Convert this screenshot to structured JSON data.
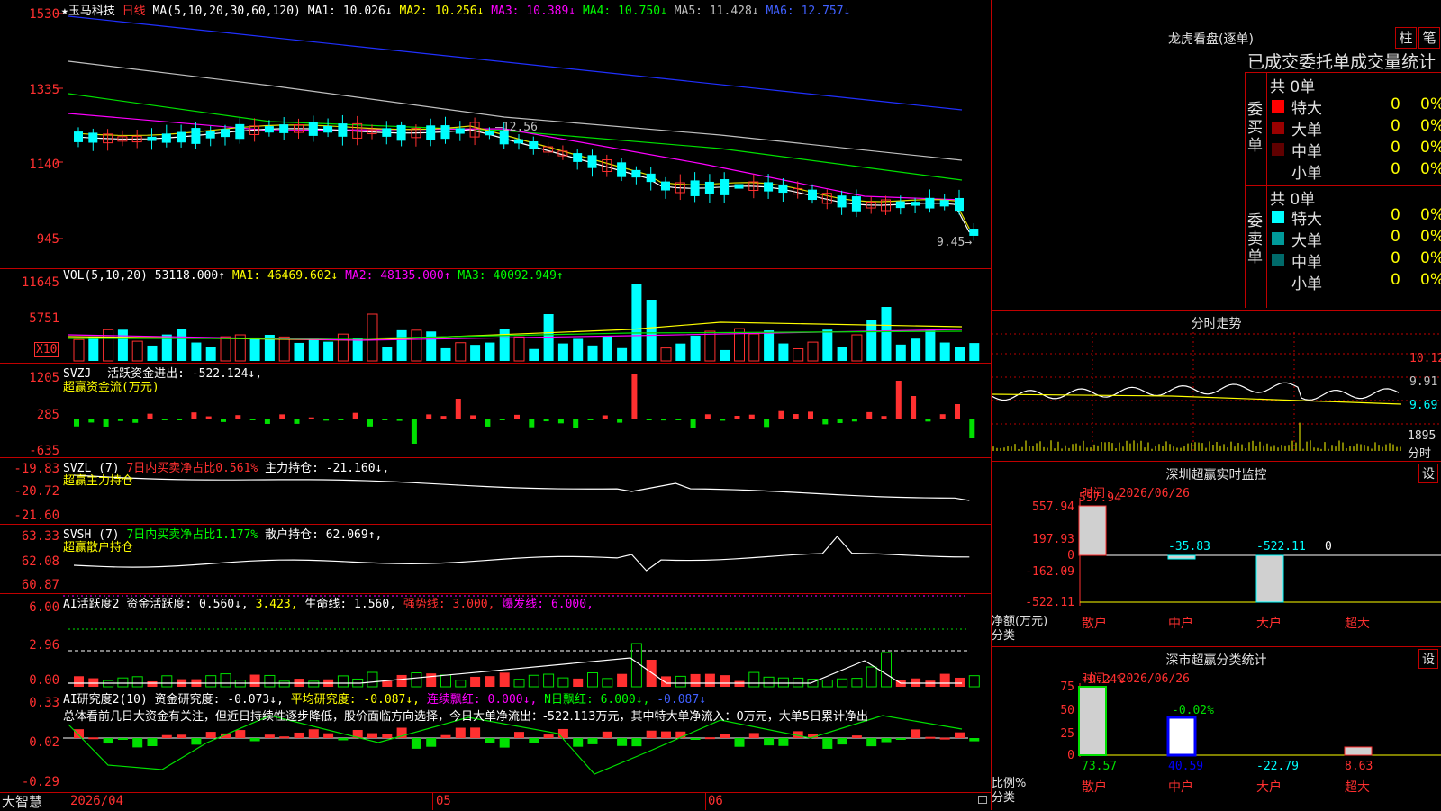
{
  "colors": {
    "up": "#ff3030",
    "down": "#00ffff",
    "grid": "#c00000"
  },
  "main": {
    "stock_name": "★玉马科技",
    "period": "日线",
    "ma_params": "MA(5,10,20,30,60,120)",
    "ma1": "MA1: 10.026↓",
    "ma2": "MA2: 10.256↓",
    "ma3": "MA3: 10.389↓",
    "ma4": "MA4: 10.750↓",
    "ma5": "MA5: 11.428↓",
    "ma6": "MA6: 12.757↓",
    "axis": [
      "1530",
      "1335",
      "1140",
      "945"
    ],
    "high_label": "12.56",
    "low_label": "9.45"
  },
  "vol": {
    "title": "VOL(5,10,20)",
    "value": "53118.000↑",
    "ma1": "MA1: 46469.602↓",
    "ma2": "MA2: 48135.000↑",
    "ma3": "MA3: 40092.949↑",
    "axis": [
      "11645",
      "5751"
    ],
    "unit": "X10"
  },
  "svzj": {
    "title": "SVZJ",
    "label": "活跃资金进出: -522.124↓,",
    "sub": "超赢资金流(万元)",
    "axis": [
      "1205",
      "285",
      "-635"
    ]
  },
  "svzl": {
    "title": "SVZL (7)",
    "pct": "7日内买卖净占比0.561%",
    "hold": "主力持仓: -21.160↓,",
    "sub": "超赢主力持仓",
    "axis": [
      "-19.83",
      "-20.72",
      "-21.60"
    ]
  },
  "svsh": {
    "title": "SVSH (7)",
    "pct": "7日内买卖净占比1.177%",
    "hold": "散户持仓: 62.069↑,",
    "sub": "超赢散户持仓",
    "axis": [
      "63.33",
      "62.08",
      "60.87"
    ]
  },
  "ai1": {
    "title": "AI活跃度2",
    "act": "资金活跃度: 0.560↓,",
    "v2": "3.423,",
    "life": "生命线: 1.560,",
    "strong": "强势线: 3.000,",
    "burst": "爆发线: 6.000,",
    "axis": [
      "6.00",
      "2.96",
      "0.00"
    ]
  },
  "ai2": {
    "title": "AI研究度2(10)",
    "research": "资金研究度: -0.073↓,",
    "avg": "平均研究度: -0.087↓,",
    "streak": "连续飘红: 0.000↓,",
    "ndays": "N日飘红: 6.000↓,",
    "last": "-0.087↓",
    "axis": [
      "0.33",
      "0.02",
      "-0.29"
    ],
    "summary": "总体看前几日大资金有关注，但近日持续性逐步降低，股价面临方向选择，今日大单净流出：-522.113万元，其中特大单净流入：0万元，大单5日累计净出"
  },
  "bottom": {
    "brand": "大智慧",
    "date": "2026/04",
    "m05": "05",
    "m06": "06"
  },
  "lhb": {
    "title": "龙虎看盘(逐单)",
    "btn1": "柱",
    "btn2": "笔",
    "header": "已成交委托单成交量统计",
    "buy_side": "委买单",
    "sell_side": "委卖单",
    "buy_total": "共 0单",
    "sell_total": "共 0单",
    "buy_rows": [
      {
        "name": "特大",
        "n": "0",
        "p": "0%"
      },
      {
        "name": "大单",
        "n": "0",
        "p": "0%"
      },
      {
        "name": "中单",
        "n": "0",
        "p": "0%"
      },
      {
        "name": "小单",
        "n": "0",
        "p": "0%"
      }
    ],
    "sell_rows": [
      {
        "name": "特大",
        "n": "0",
        "p": "0%"
      },
      {
        "name": "大单",
        "n": "0",
        "p": "0%"
      },
      {
        "name": "中单",
        "n": "0",
        "p": "0%"
      },
      {
        "name": "小单",
        "n": "0",
        "p": "0%"
      }
    ]
  },
  "fenshi": {
    "title": "分时走势",
    "p1": "10.12",
    "p2": "9.91",
    "p3": "9.69",
    "vol": "1895",
    "lbl": "分时"
  },
  "sz_monitor": {
    "title": "深圳超赢实时监控",
    "set": "设",
    "time": "时间: 2026/06/26",
    "axis": [
      "557.94",
      "197.93",
      "0",
      "-162.09",
      "-522.11"
    ],
    "vals": {
      "retail": "557.94",
      "mid": "-35.83",
      "large": "-522.11",
      "super": "0"
    },
    "ylabel": "净额(万元)",
    "xlabel": "分类",
    "cats": [
      "散户",
      "中户",
      "大户",
      "超大"
    ]
  },
  "sz_class": {
    "title": "深市超赢分类统计",
    "set": "设",
    "time": "时间: 2026/06/26",
    "axis": [
      "75",
      "50",
      "25",
      "0"
    ],
    "top1": "+0.24%",
    "top2": "-0.02%",
    "vals": [
      "73.57",
      "40.59",
      "-22.79",
      "8.63"
    ],
    "ylabel": "比例%",
    "xlabel": "分类",
    "cats": [
      "散户",
      "中户",
      "大户",
      "超大"
    ]
  }
}
